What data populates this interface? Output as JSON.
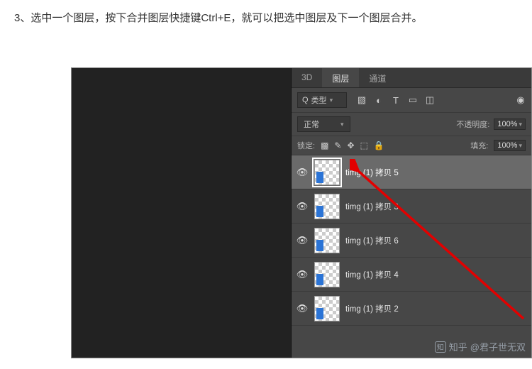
{
  "instruction": "3、选中一个图层，按下合并图层快捷键Ctrl+E，就可以把选中图层及下一个图层合并。",
  "tabs": {
    "tab3d": "3D",
    "layers": "图层",
    "channels": "通道"
  },
  "filter": {
    "type_label": "类型",
    "search_prefix": "Q"
  },
  "blend": {
    "mode": "正常",
    "opacity_label": "不透明度:",
    "opacity_value": "100%"
  },
  "lock": {
    "label": "锁定:",
    "fill_label": "填充:",
    "fill_value": "100%"
  },
  "layers": [
    {
      "name": "timg (1) 拷贝 5",
      "selected": true
    },
    {
      "name": "timg (1) 拷贝 3",
      "selected": false
    },
    {
      "name": "timg (1) 拷贝 6",
      "selected": false
    },
    {
      "name": "timg (1) 拷贝 4",
      "selected": false
    },
    {
      "name": "timg (1) 拷贝 2",
      "selected": false
    }
  ],
  "watermark": {
    "site": "知乎",
    "author": "@君子世无双"
  }
}
